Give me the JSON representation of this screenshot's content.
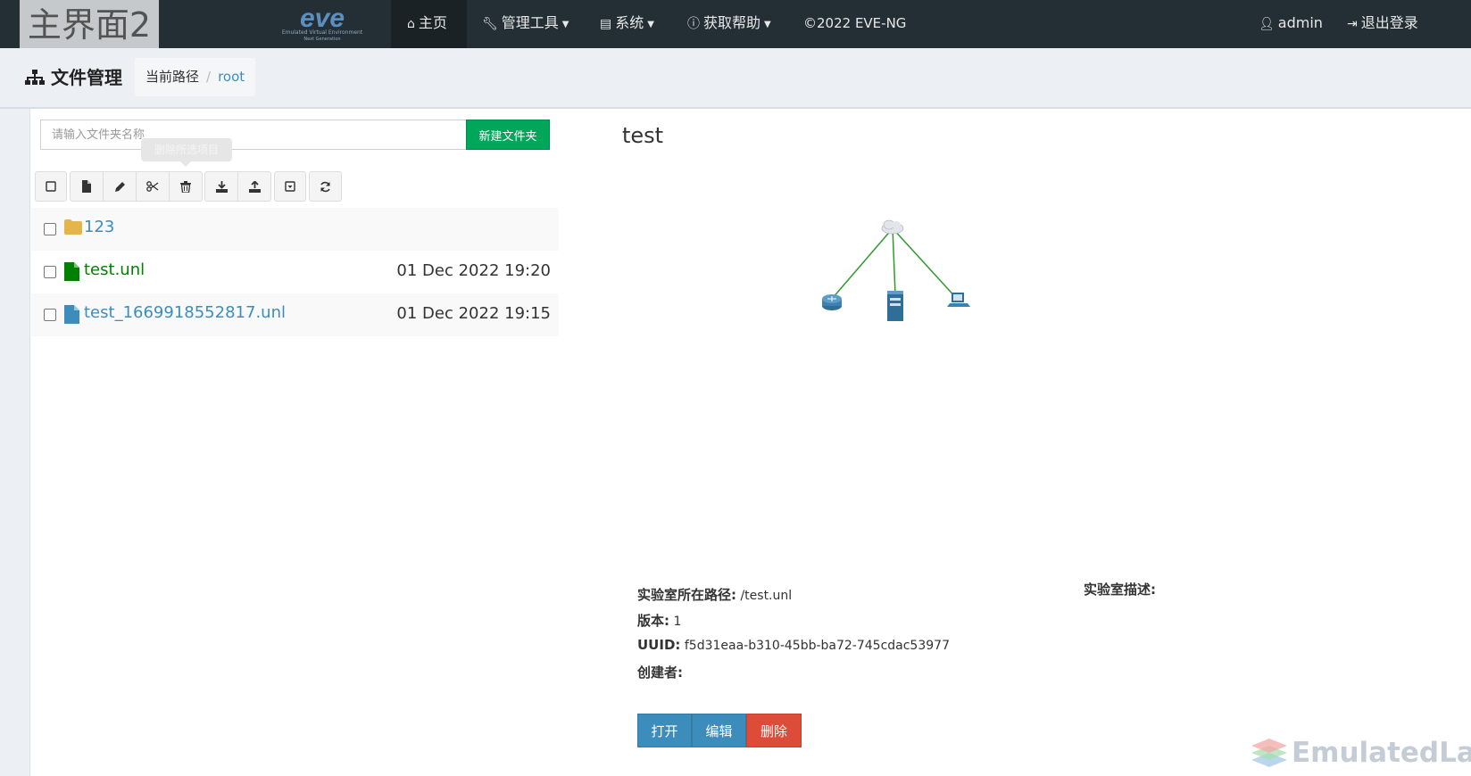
{
  "watermark": "主界面2",
  "brand": {
    "logo": "eve",
    "tagline": "Emulated Virtual Environment",
    "subline": "Next Generation"
  },
  "nav": {
    "home": "主页",
    "tools": "管理工具",
    "system": "系统",
    "help": "获取帮助",
    "copyright": "©2022 EVE-NG",
    "user": "admin",
    "logout": "退出登录"
  },
  "header": {
    "title": "文件管理",
    "breadcrumb_label": "当前路径",
    "breadcrumb_sep": "/",
    "breadcrumb_root": "root"
  },
  "search": {
    "placeholder": "请输入文件夹名称"
  },
  "new_folder_button": "新建文件夹",
  "tooltip": "删除所选项目",
  "toolbar_icons": [
    "checkbox-icon",
    "new-file-icon",
    "pencil-icon",
    "scissors-icon",
    "trash-icon",
    "download-icon",
    "upload-icon",
    "archive-icon",
    "refresh-icon"
  ],
  "files": [
    {
      "name": "123",
      "date": "",
      "type": "folder",
      "color": "#e4b54a"
    },
    {
      "name": "test.unl",
      "date": "01 Dec 2022 19:20",
      "type": "lab",
      "color": "#008000"
    },
    {
      "name": "test_1669918552817.unl",
      "date": "01 Dec 2022 19:15",
      "type": "lab",
      "color": "#3c8dbc"
    }
  ],
  "lab": {
    "title": "test",
    "path_label": "实验室所在路径:",
    "path_value": "/test.unl",
    "version_label": "版本:",
    "version_value": "1",
    "uuid_label": "UUID:",
    "uuid_value": "f5d31eaa-b310-45bb-ba72-745cdac53977",
    "creator_label": "创建者:",
    "description_label": "实验室描述:"
  },
  "actions": {
    "open": "打开",
    "edit": "编辑",
    "delete": "删除"
  },
  "topology_icons": [
    "cloud-icon",
    "router-icon",
    "server-icon",
    "pc-icon"
  ],
  "footer_watermark": "EmulatedLab",
  "colors": {
    "navbar": "#242f35",
    "accent": "#3c8dbc",
    "success": "#00a65a",
    "danger": "#dd4b39"
  }
}
